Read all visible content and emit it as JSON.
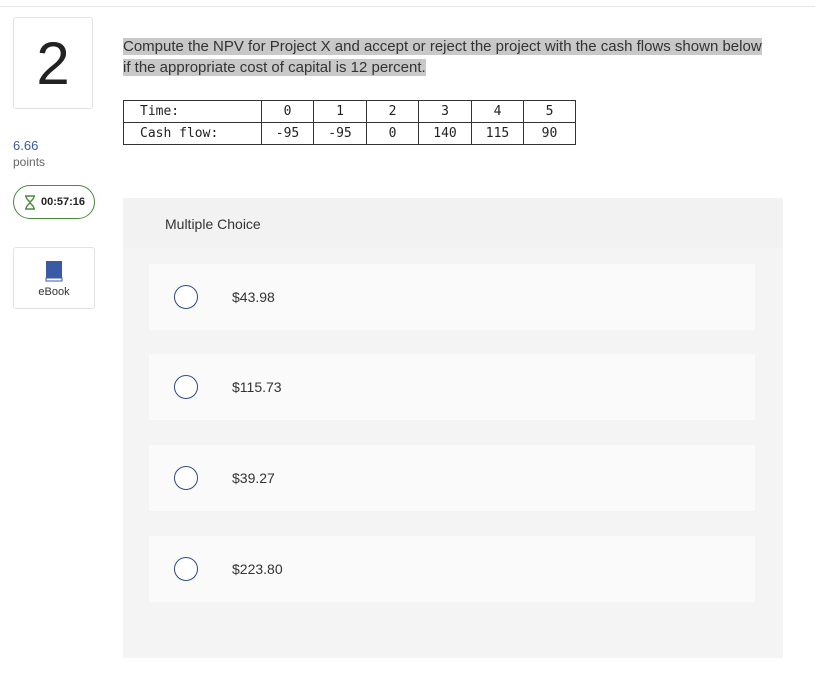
{
  "question": {
    "number": "2",
    "points_value": "6.66",
    "points_label": "points",
    "timer": "00:57:16",
    "ebook_label": "eBook",
    "prompt": "Compute the NPV for Project X and accept or reject the project with the cash flows shown below if the appropriate cost of capital is 12 percent."
  },
  "cash_table": {
    "row1_label": "Time:",
    "row2_label": "Cash flow:",
    "times": [
      "0",
      "1",
      "2",
      "3",
      "4",
      "5"
    ],
    "flows": [
      "-95",
      "-95",
      "0",
      "140",
      "115",
      "90"
    ]
  },
  "multiple_choice": {
    "header": "Multiple Choice",
    "options": [
      "$43.98",
      "$115.73",
      "$39.27",
      "$223.80"
    ]
  },
  "colors": {
    "accent": "#2c4a86",
    "timer_border": "#4a8a3a",
    "points": "#3a5a9a"
  },
  "icons": {
    "timer": "hourglass-icon",
    "ebook": "book-icon"
  }
}
